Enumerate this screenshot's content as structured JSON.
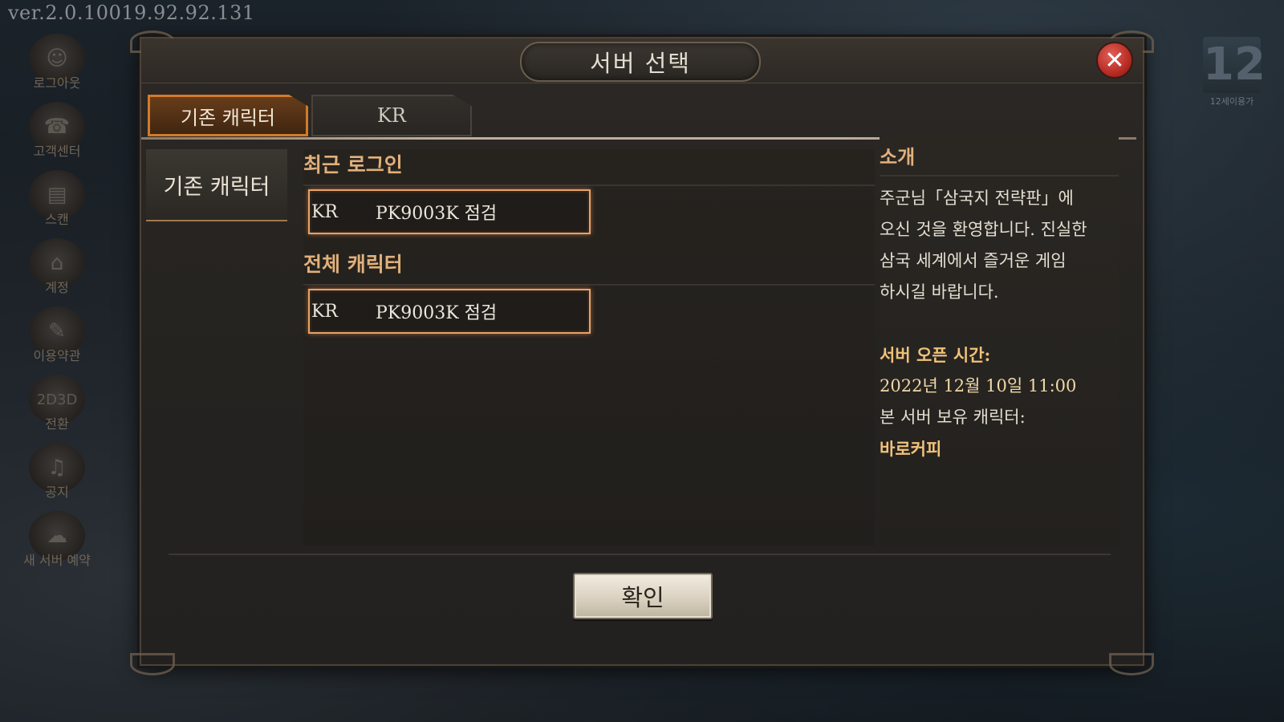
{
  "version": "ver.2.0.10019.92.92.131",
  "sidebar": {
    "items": [
      {
        "label": "로그아웃",
        "icon": "logout-icon"
      },
      {
        "label": "고객센터",
        "icon": "customer-center-icon"
      },
      {
        "label": "스캔",
        "icon": "scan-icon"
      },
      {
        "label": "계정",
        "icon": "account-icon"
      },
      {
        "label": "이용약관",
        "icon": "terms-icon"
      },
      {
        "label": "전환",
        "icon": "2d-3d-switch-icon"
      },
      {
        "label": "공지",
        "icon": "notice-icon"
      },
      {
        "label": "새 서버 예약",
        "icon": "new-server-reservation-icon"
      }
    ]
  },
  "age_rating": {
    "number": "12",
    "label": "12세이용가"
  },
  "dialog": {
    "title": "서버 선택",
    "close_symbol": "✕",
    "tabs": [
      {
        "label": "기존 캐릭터",
        "active": true
      },
      {
        "label": "KR",
        "active": false
      }
    ],
    "category": "기존 캐릭터",
    "recent_title": "최근 로그인",
    "recent_server": {
      "region": "KR",
      "name": "PK9003K 점검"
    },
    "all_title": "전체 캐릭터",
    "all_server": {
      "region": "KR",
      "name": "PK9003K 점검"
    },
    "intro": {
      "title": "소개",
      "line1": "주군님「삼국지 전략판」에",
      "line2": "오신 것을 환영합니다. 진실한",
      "line3": "삼국 세계에서 즐거운 게임",
      "line4": "하시길 바랍니다.",
      "open_label": "서버 오픈 시간:",
      "open_time": "2022년 12월 10일 11:00",
      "owner_label": "본 서버 보유 캐릭터:",
      "owner_name": "바로커피"
    },
    "confirm_label": "확인"
  },
  "colors": {
    "accent_orange": "#d27a2a",
    "gold_text": "#e1b07a",
    "close_red": "#b82c24"
  }
}
